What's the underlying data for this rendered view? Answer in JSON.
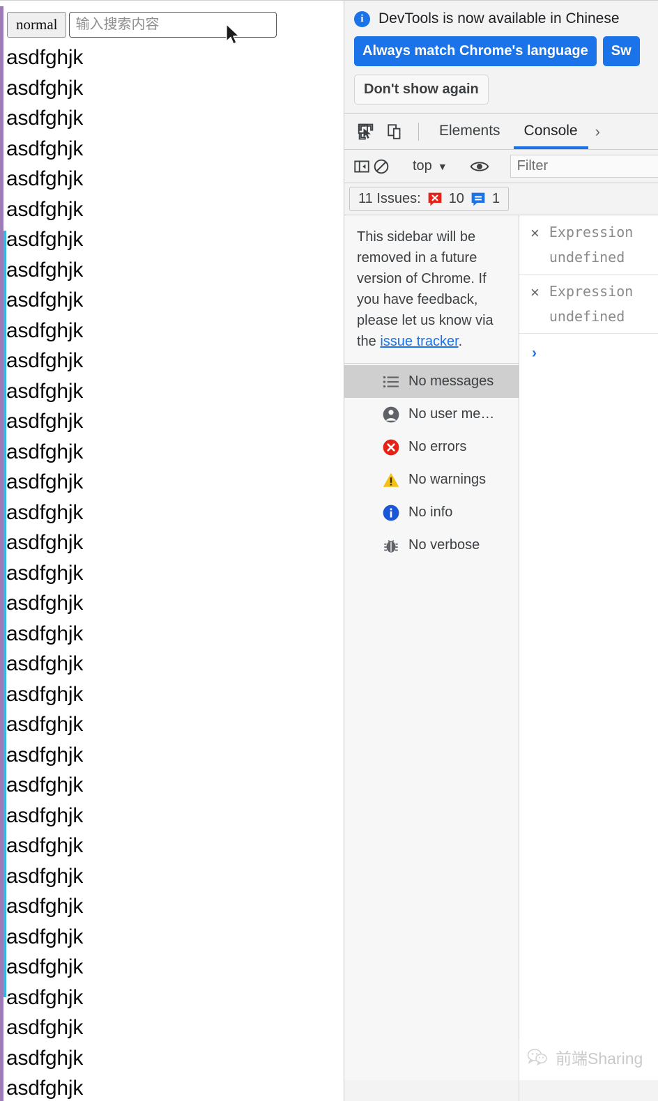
{
  "page": {
    "toolbar": {
      "mode_button": "normal",
      "search_placeholder": "输入搜索内容",
      "search_value": ""
    },
    "list_items": [
      "asdfghjk",
      "asdfghjk",
      "asdfghjk",
      "asdfghjk",
      "asdfghjk",
      "asdfghjk",
      "asdfghjk",
      "asdfghjk",
      "asdfghjk",
      "asdfghjk",
      "asdfghjk",
      "asdfghjk",
      "asdfghjk",
      "asdfghjk",
      "asdfghjk",
      "asdfghjk",
      "asdfghjk",
      "asdfghjk",
      "asdfghjk",
      "asdfghjk",
      "asdfghjk",
      "asdfghjk",
      "asdfghjk",
      "asdfghjk",
      "asdfghjk",
      "asdfghjk",
      "asdfghjk",
      "asdfghjk",
      "asdfghjk",
      "asdfghjk",
      "asdfghjk",
      "asdfghjk",
      "asdfghjk",
      "asdfghjk",
      "asdfghjk"
    ]
  },
  "devtools": {
    "language_banner": {
      "icon": "info-icon",
      "message": "DevTools is now available in Chinese",
      "primary_action": "Always match Chrome's language",
      "secondary_action": "Sw",
      "dismiss_action": "Don't show again"
    },
    "tabbar": {
      "inspect_icon": "inspect-element-icon",
      "device_icon": "device-toolbar-icon",
      "tabs": [
        {
          "label": "Elements",
          "active": false
        },
        {
          "label": "Console",
          "active": true
        }
      ],
      "overflow": "›"
    },
    "console_toolbar": {
      "sidebar_toggle_icon": "console-sidebar-toggle-icon",
      "clear_icon": "clear-console-icon",
      "context": "top",
      "context_caret": "▼",
      "eye_icon": "live-expression-icon",
      "filter_placeholder": "Filter",
      "filter_value": ""
    },
    "issues_bar": {
      "label": "11 Issues:",
      "error_count": "10",
      "info_count": "1",
      "error_icon": "error-badge-icon",
      "info_icon": "info-badge-icon"
    },
    "sidebar": {
      "notice_prefix": "This sidebar will be removed in a future version of Chrome. If you have feedback, please let us know via the ",
      "notice_link": "issue tracker",
      "notice_suffix": ".",
      "items": [
        {
          "label": "No messages",
          "icon": "list-icon",
          "selected": true
        },
        {
          "label": "No user me…",
          "icon": "person-icon",
          "selected": false
        },
        {
          "label": "No errors",
          "icon": "error-icon",
          "selected": false
        },
        {
          "label": "No warnings",
          "icon": "warning-icon",
          "selected": false
        },
        {
          "label": "No info",
          "icon": "info-icon",
          "selected": false
        },
        {
          "label": "No verbose",
          "icon": "bug-icon",
          "selected": false
        }
      ]
    },
    "console_output": {
      "watch_rows": [
        {
          "remove_icon": "×",
          "expression": "Expression",
          "value": "undefined"
        },
        {
          "remove_icon": "×",
          "expression": "Expression",
          "value": "undefined"
        }
      ],
      "prompt_caret": "›"
    }
  },
  "watermark": {
    "icon": "wechat-icon",
    "text": "前端Sharing"
  },
  "colors": {
    "accent_blue": "#1a73e8",
    "error_red": "#e62117",
    "warning_yellow": "#f5c016",
    "rail_purple": "#9b7cb8",
    "rail_cyan": "#35b8e0"
  }
}
